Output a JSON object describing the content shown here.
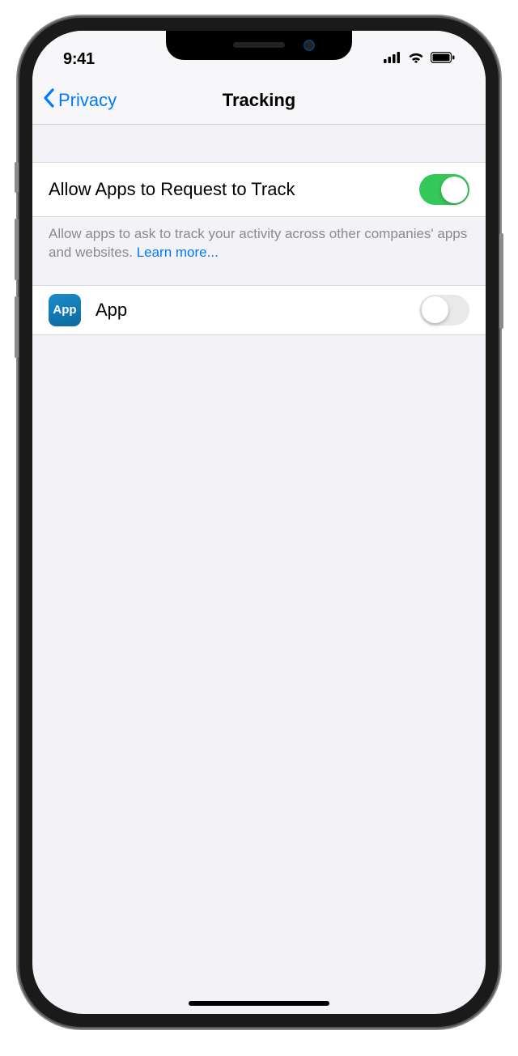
{
  "status": {
    "time": "9:41"
  },
  "nav": {
    "back": "Privacy",
    "title": "Tracking"
  },
  "allowRow": {
    "label": "Allow Apps to Request to Track",
    "on": true
  },
  "footer": {
    "text": "Allow apps to ask to track your activity across other companies' apps and websites. ",
    "link": "Learn more..."
  },
  "apps": [
    {
      "iconText": "App",
      "name": "App",
      "on": false
    }
  ]
}
